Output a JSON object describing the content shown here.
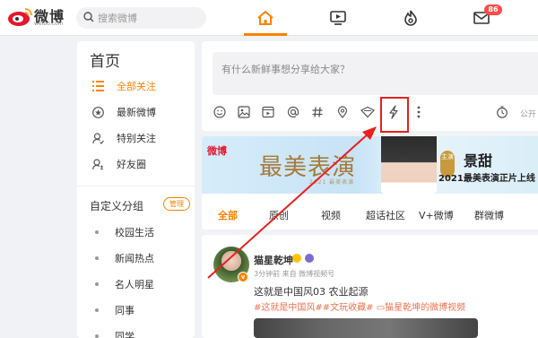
{
  "header": {
    "logo_text": "微博",
    "logo_sub": "weibo.com",
    "search_placeholder": "搜索微博",
    "message_badge": "86"
  },
  "sidebar": {
    "title": "首页",
    "items": [
      {
        "label": "全部关注",
        "icon": "list-icon",
        "active": true
      },
      {
        "label": "最新微博",
        "icon": "star-icon",
        "active": false
      },
      {
        "label": "特别关注",
        "icon": "user-check-icon",
        "active": false
      },
      {
        "label": "好友圈",
        "icon": "friends-icon",
        "active": false
      }
    ],
    "group_title": "自定义分组",
    "manage_label": "管理",
    "groups": [
      "校园生活",
      "新闻热点",
      "名人明星",
      "同事",
      "同学"
    ]
  },
  "composer": {
    "placeholder": "有什么新鲜事想分享给大家？",
    "tools": [
      "emoji-icon",
      "image-icon",
      "video-icon",
      "mention-icon",
      "topic-icon",
      "location-icon",
      "headline-icon",
      "flash-icon",
      "more-icon",
      "timer-icon"
    ],
    "publish_label": "公开"
  },
  "banner": {
    "logo": "微博",
    "title": "最美表演",
    "subtitle": "2021 最美表演",
    "badge": "主演",
    "name": "景甜",
    "caption": "2021最美表演正片上线"
  },
  "feed_tabs": [
    "全部",
    "原创",
    "视频",
    "超话社区",
    "V+微博",
    "群微博"
  ],
  "post": {
    "author": "猫星乾坤",
    "meta": "3分钟前 来自 微博视频号",
    "text": "这就是中国风03 农业起源",
    "tags": "#这就是中国风##文玩收藏#  ▭猫星乾坤的微博视频"
  },
  "colors": {
    "accent": "#ff8200",
    "highlight": "#e8201e",
    "tag": "#eb7350",
    "badge": "#ff4a4a"
  }
}
